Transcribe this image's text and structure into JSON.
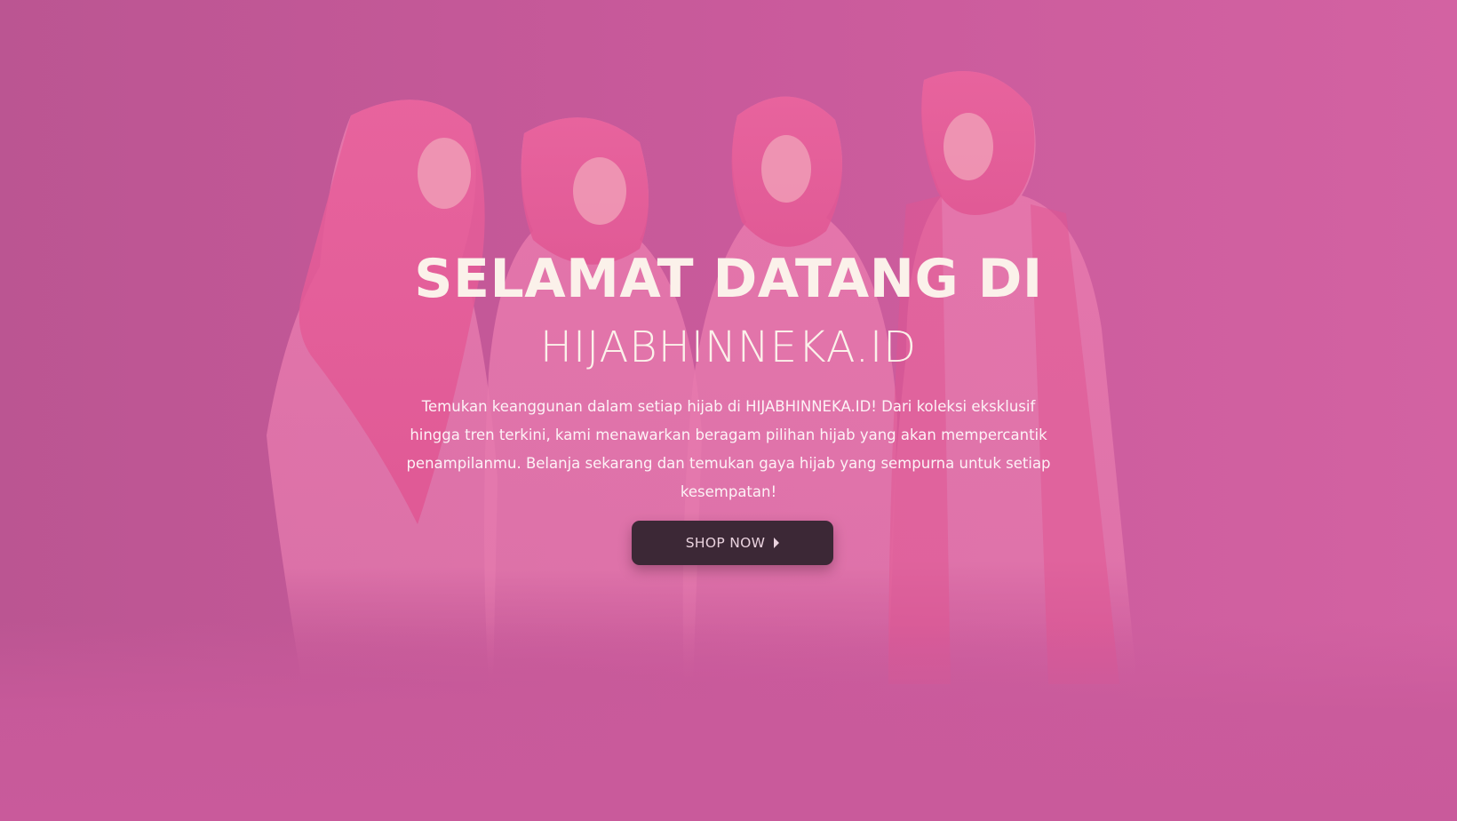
{
  "hero": {
    "headline": "SELAMAT DATANG DI",
    "brand": "HIJABHINNEKA.ID",
    "description": "Temukan keanggunan dalam setiap hijab di HIJABHINNEKA.ID! Dari koleksi eksklusif hingga tren terkini, kami menawarkan beragam pilihan hijab yang akan mempercantik penampilanmu. Belanja sekarang dan temukan gaya hijab yang sempurna untuk setiap kesempatan!",
    "cta_label": "SHOP NOW",
    "cta_icon": "caret-right-icon",
    "background_image": "four-women-in-pink-hijabs-photo"
  },
  "colors": {
    "background_left": "#bb5592",
    "background_right": "#d362a2",
    "text": "#fbf1ea",
    "button_bg": "#3c2836",
    "button_text": "#e9d2de"
  }
}
